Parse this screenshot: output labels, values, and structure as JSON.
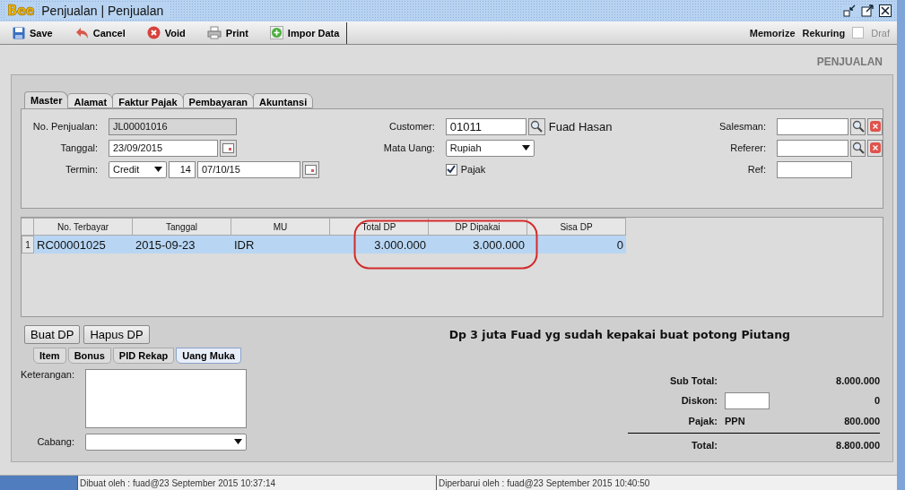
{
  "window": {
    "logo": "Bee",
    "title": "Penjualan | Penjualan"
  },
  "toolbar": {
    "buttons": [
      "Save",
      "Cancel",
      "Void",
      "Print",
      "Impor Data"
    ],
    "right_links": [
      "Memorize",
      "Rekuring"
    ],
    "draft": {
      "label": "Draf",
      "checked": false,
      "disabled": true
    }
  },
  "section_title": "PENJUALAN",
  "tabs": [
    {
      "label": "Master",
      "selected": true
    },
    {
      "label": "Alamat",
      "selected": false
    },
    {
      "label": "Faktur Pajak",
      "selected": false
    },
    {
      "label": "Pembayaran",
      "selected": false
    },
    {
      "label": "Akuntansi",
      "selected": false
    }
  ],
  "master": {
    "no_penjualan": {
      "label": "No. Penjualan:",
      "value": "JL00001016"
    },
    "tanggal": {
      "label": "Tanggal:",
      "value": "23/09/2015"
    },
    "termin": {
      "label": "Termin:",
      "type": "Credit",
      "days": "14",
      "due": "07/10/15"
    },
    "customer": {
      "label": "Customer:",
      "code": "01011",
      "name": "Fuad Hasan"
    },
    "mata_uang": {
      "label": "Mata Uang:",
      "value": "Rupiah"
    },
    "pajak": {
      "label": "Pajak",
      "checked": true
    },
    "salesman": {
      "label": "Salesman:"
    },
    "referer": {
      "label": "Referer:"
    },
    "ref": {
      "label": "Ref:"
    }
  },
  "dp_table": {
    "columns": [
      "No. Terbayar",
      "Tanggal",
      "MU",
      "Total DP",
      "DP Dipakai",
      "Sisa DP"
    ],
    "rows": [
      {
        "number": "1",
        "selected": true,
        "cells": [
          "RC00001025",
          "2015-09-23",
          "IDR",
          "3.000.000",
          "3.000.000",
          "0"
        ]
      }
    ]
  },
  "dp_buttons": [
    "Buat DP",
    "Hapus DP"
  ],
  "note": "Dp 3 juta Fuad yg sudah kepakai buat potong Piutang",
  "bottom_tabs": [
    {
      "label": "Item",
      "selected": false
    },
    {
      "label": "Bonus",
      "selected": false
    },
    {
      "label": "PID Rekap",
      "selected": false
    },
    {
      "label": "Uang Muka",
      "selected": true
    }
  ],
  "keterangan": {
    "label": "Keterangan:"
  },
  "cabang": {
    "label": "Cabang:"
  },
  "totals": {
    "sub_total": {
      "label": "Sub Total:",
      "value": "8.000.000"
    },
    "diskon": {
      "label": "Diskon:",
      "value": "0"
    },
    "pajak": {
      "label": "Pajak:",
      "code": "PPN",
      "value": "800.000"
    },
    "total": {
      "label": "Total:",
      "value": "8.800.000"
    }
  },
  "status_progress": {
    "level": 1
  },
  "status_bar": [
    "Dibuat oleh : fuad@23 September 2015  10:37:14",
    "Diperbarui oleh : fuad@23 September 2015  10:40:50"
  ]
}
